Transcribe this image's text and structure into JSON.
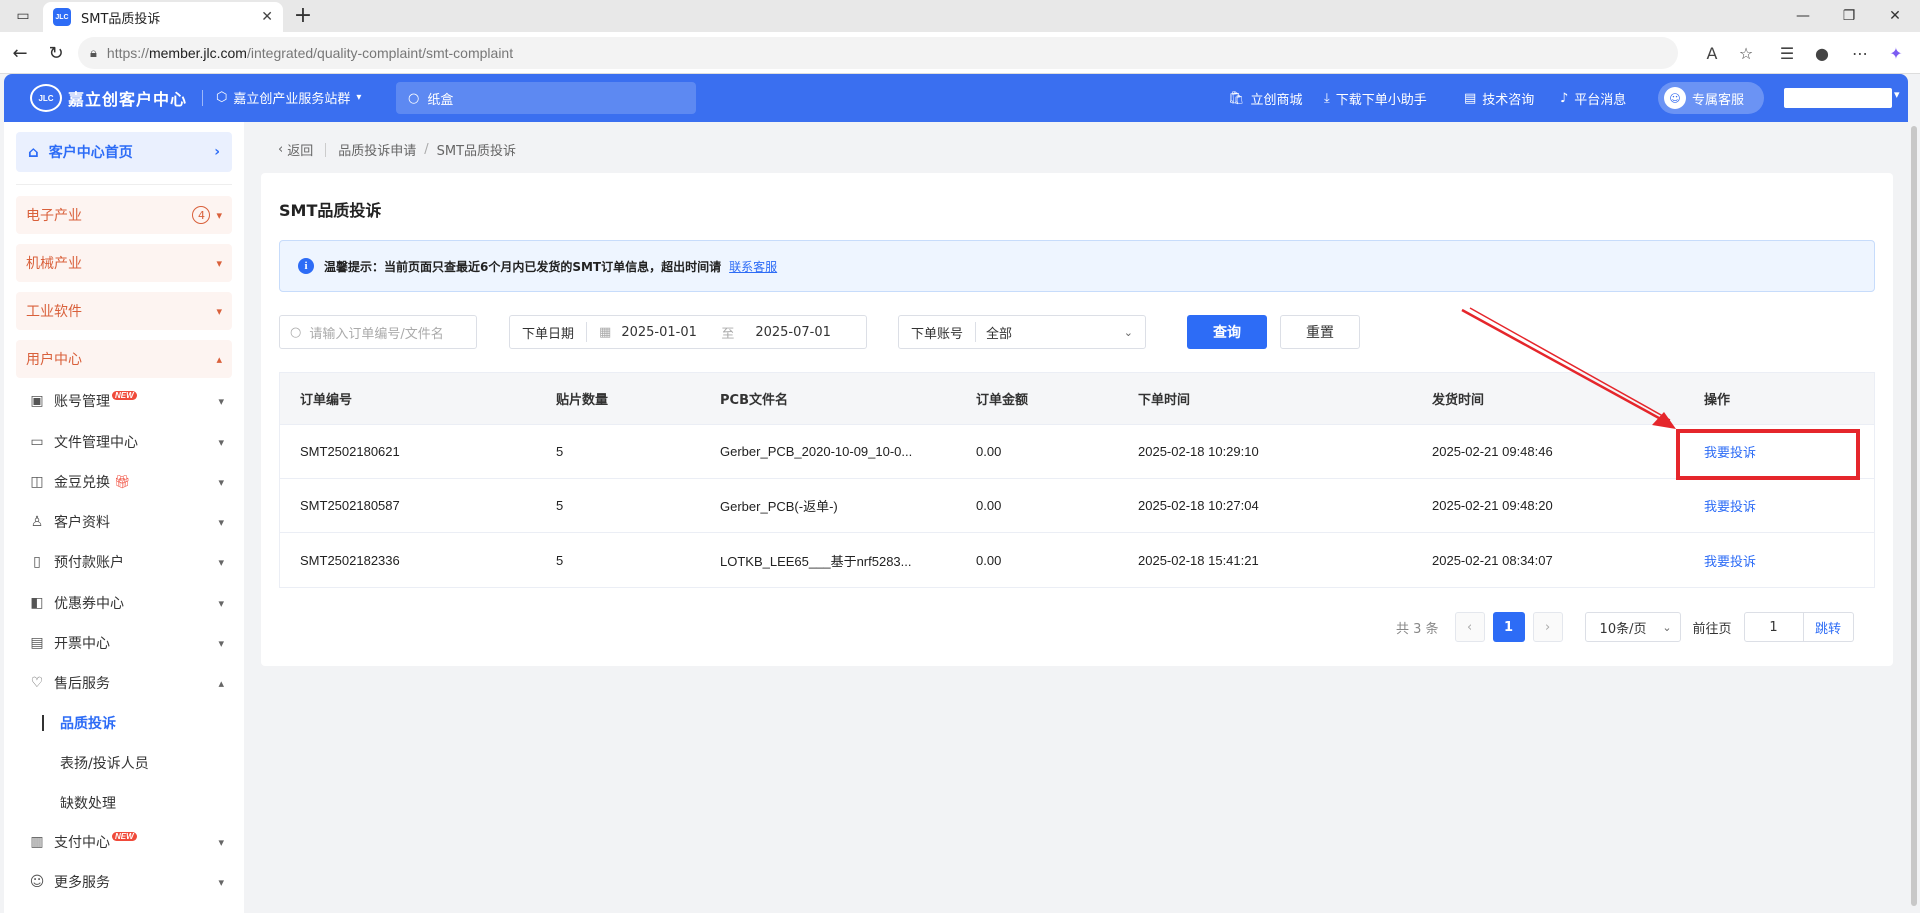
{
  "browser": {
    "tab_title": "SMT品质投诉",
    "favicon_text": "JLC",
    "url_prefix": "https://",
    "url_host": "member.jlc.com",
    "url_path": "/integrated/quality-complaint/smt-complaint"
  },
  "header": {
    "logo_mark": "JLC",
    "logo_text": "嘉立创客户中心",
    "station": "嘉立创产业服务站群",
    "search_placeholder": "纸盒",
    "links": [
      "立创商城",
      "下载下单小助手",
      "技术咨询",
      "平台消息"
    ],
    "service": "专属客服"
  },
  "sidebar": {
    "home": "客户中心首页",
    "categories": [
      {
        "label": "电子产业",
        "badge": "4"
      },
      {
        "label": "机械产业"
      },
      {
        "label": "工业软件"
      },
      {
        "label": "用户中心"
      }
    ],
    "items": [
      {
        "label": "账号管理",
        "new": "NEW"
      },
      {
        "label": "文件管理中心"
      },
      {
        "label": "金豆兑换"
      },
      {
        "label": "客户资料"
      },
      {
        "label": "预付款账户"
      },
      {
        "label": "优惠券中心"
      },
      {
        "label": "开票中心"
      },
      {
        "label": "售后服务"
      },
      {
        "label": "支付中心",
        "new": "NEW"
      },
      {
        "label": "更多服务"
      }
    ],
    "sub_items": [
      "品质投诉",
      "表扬/投诉人员",
      "缺数处理"
    ]
  },
  "breadcrumb": {
    "back": "返回",
    "level1": "品质投诉申请",
    "level2": "SMT品质投诉"
  },
  "page": {
    "title": "SMT品质投诉",
    "notice": "温馨提示：当前页面只查最近6个月内已发货的SMT订单信息，超出时间请",
    "notice_link": "联系客服"
  },
  "filters": {
    "search_placeholder": "请输入订单编号/文件名",
    "date_label": "下单日期",
    "date_from": "2025-01-01",
    "date_sep": "至",
    "date_to": "2025-07-01",
    "account_label": "下单账号",
    "account_value": "全部",
    "query": "查询",
    "reset": "重置"
  },
  "table": {
    "headers": [
      "订单编号",
      "贴片数量",
      "PCB文件名",
      "订单金额",
      "下单时间",
      "发货时间",
      "操作"
    ],
    "rows": [
      {
        "order": "SMT2502180621",
        "qty": "5",
        "file": "Gerber_PCB_2020-10-09_10-0...",
        "amount": "0.00",
        "ordered": "2025-02-18 10:29:10",
        "shipped": "2025-02-21 09:48:46",
        "action": "我要投诉"
      },
      {
        "order": "SMT2502180587",
        "qty": "5",
        "file": "Gerber_PCB(-返单-)",
        "amount": "0.00",
        "ordered": "2025-02-18 10:27:04",
        "shipped": "2025-02-21 09:48:20",
        "action": "我要投诉"
      },
      {
        "order": "SMT2502182336",
        "qty": "5",
        "file": "LOTKB_LEE65___基于nrf5283...",
        "amount": "0.00",
        "ordered": "2025-02-18 15:41:21",
        "shipped": "2025-02-21 08:34:07",
        "action": "我要投诉"
      }
    ]
  },
  "pagination": {
    "total": "共 3 条",
    "current": "1",
    "page_size": "10条/页",
    "goto_label": "前往页",
    "goto_value": "1",
    "jump": "跳转"
  },
  "colors": {
    "primary": "#2d6cf6",
    "header_bg": "#3a6ff0",
    "category_text": "#d9603b",
    "annotation": "#e5262b"
  }
}
